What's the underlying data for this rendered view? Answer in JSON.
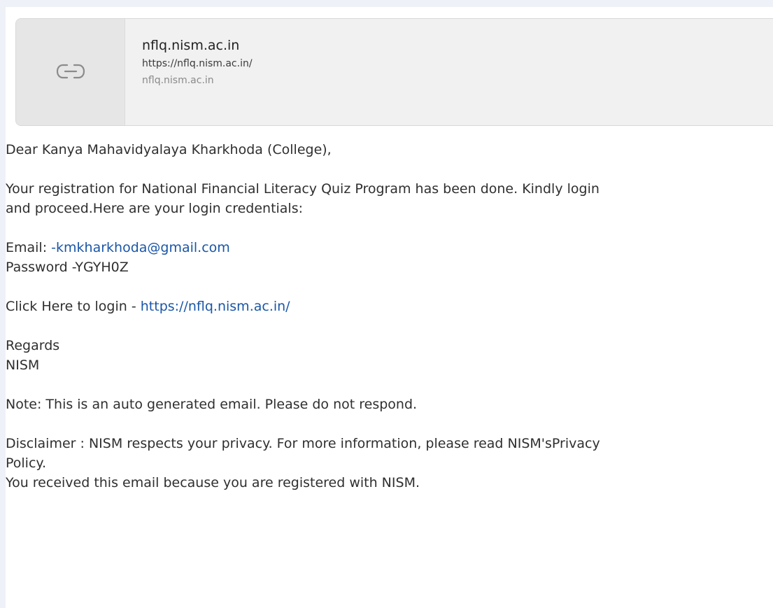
{
  "link_preview": {
    "title": "nflq.nism.ac.in",
    "url": "https://nflq.nism.ac.in/",
    "domain": "nflq.nism.ac.in",
    "icon": "link-icon"
  },
  "email": {
    "greeting": "Dear Kanya Mahavidyalaya Kharkhoda (College),",
    "registration_line_1": "Your registration for National Financial Literacy Quiz Program has been done. Kindly login",
    "registration_line_2": "and proceed.Here are your login credentials:",
    "email_label": "Email: ",
    "email_value": "-kmkharkhoda@gmail.com",
    "password_line": "Password -YGYH0Z",
    "login_prefix": "Click Here to login - ",
    "login_link": "https://nflq.nism.ac.in/",
    "regards": "Regards",
    "signature": "NISM",
    "note": "Note: This is an auto generated email. Please do not respond.",
    "disclaimer_line_1": "Disclaimer : NISM respects your privacy. For more information, please read NISM'sPrivacy",
    "disclaimer_line_2": "Policy.",
    "received_reason": "You received this email because you are registered with NISM."
  },
  "colors": {
    "background": "#eef1f7",
    "link": "#1a56a7",
    "text": "#2f2f2f",
    "card": "#f1f1f1"
  }
}
